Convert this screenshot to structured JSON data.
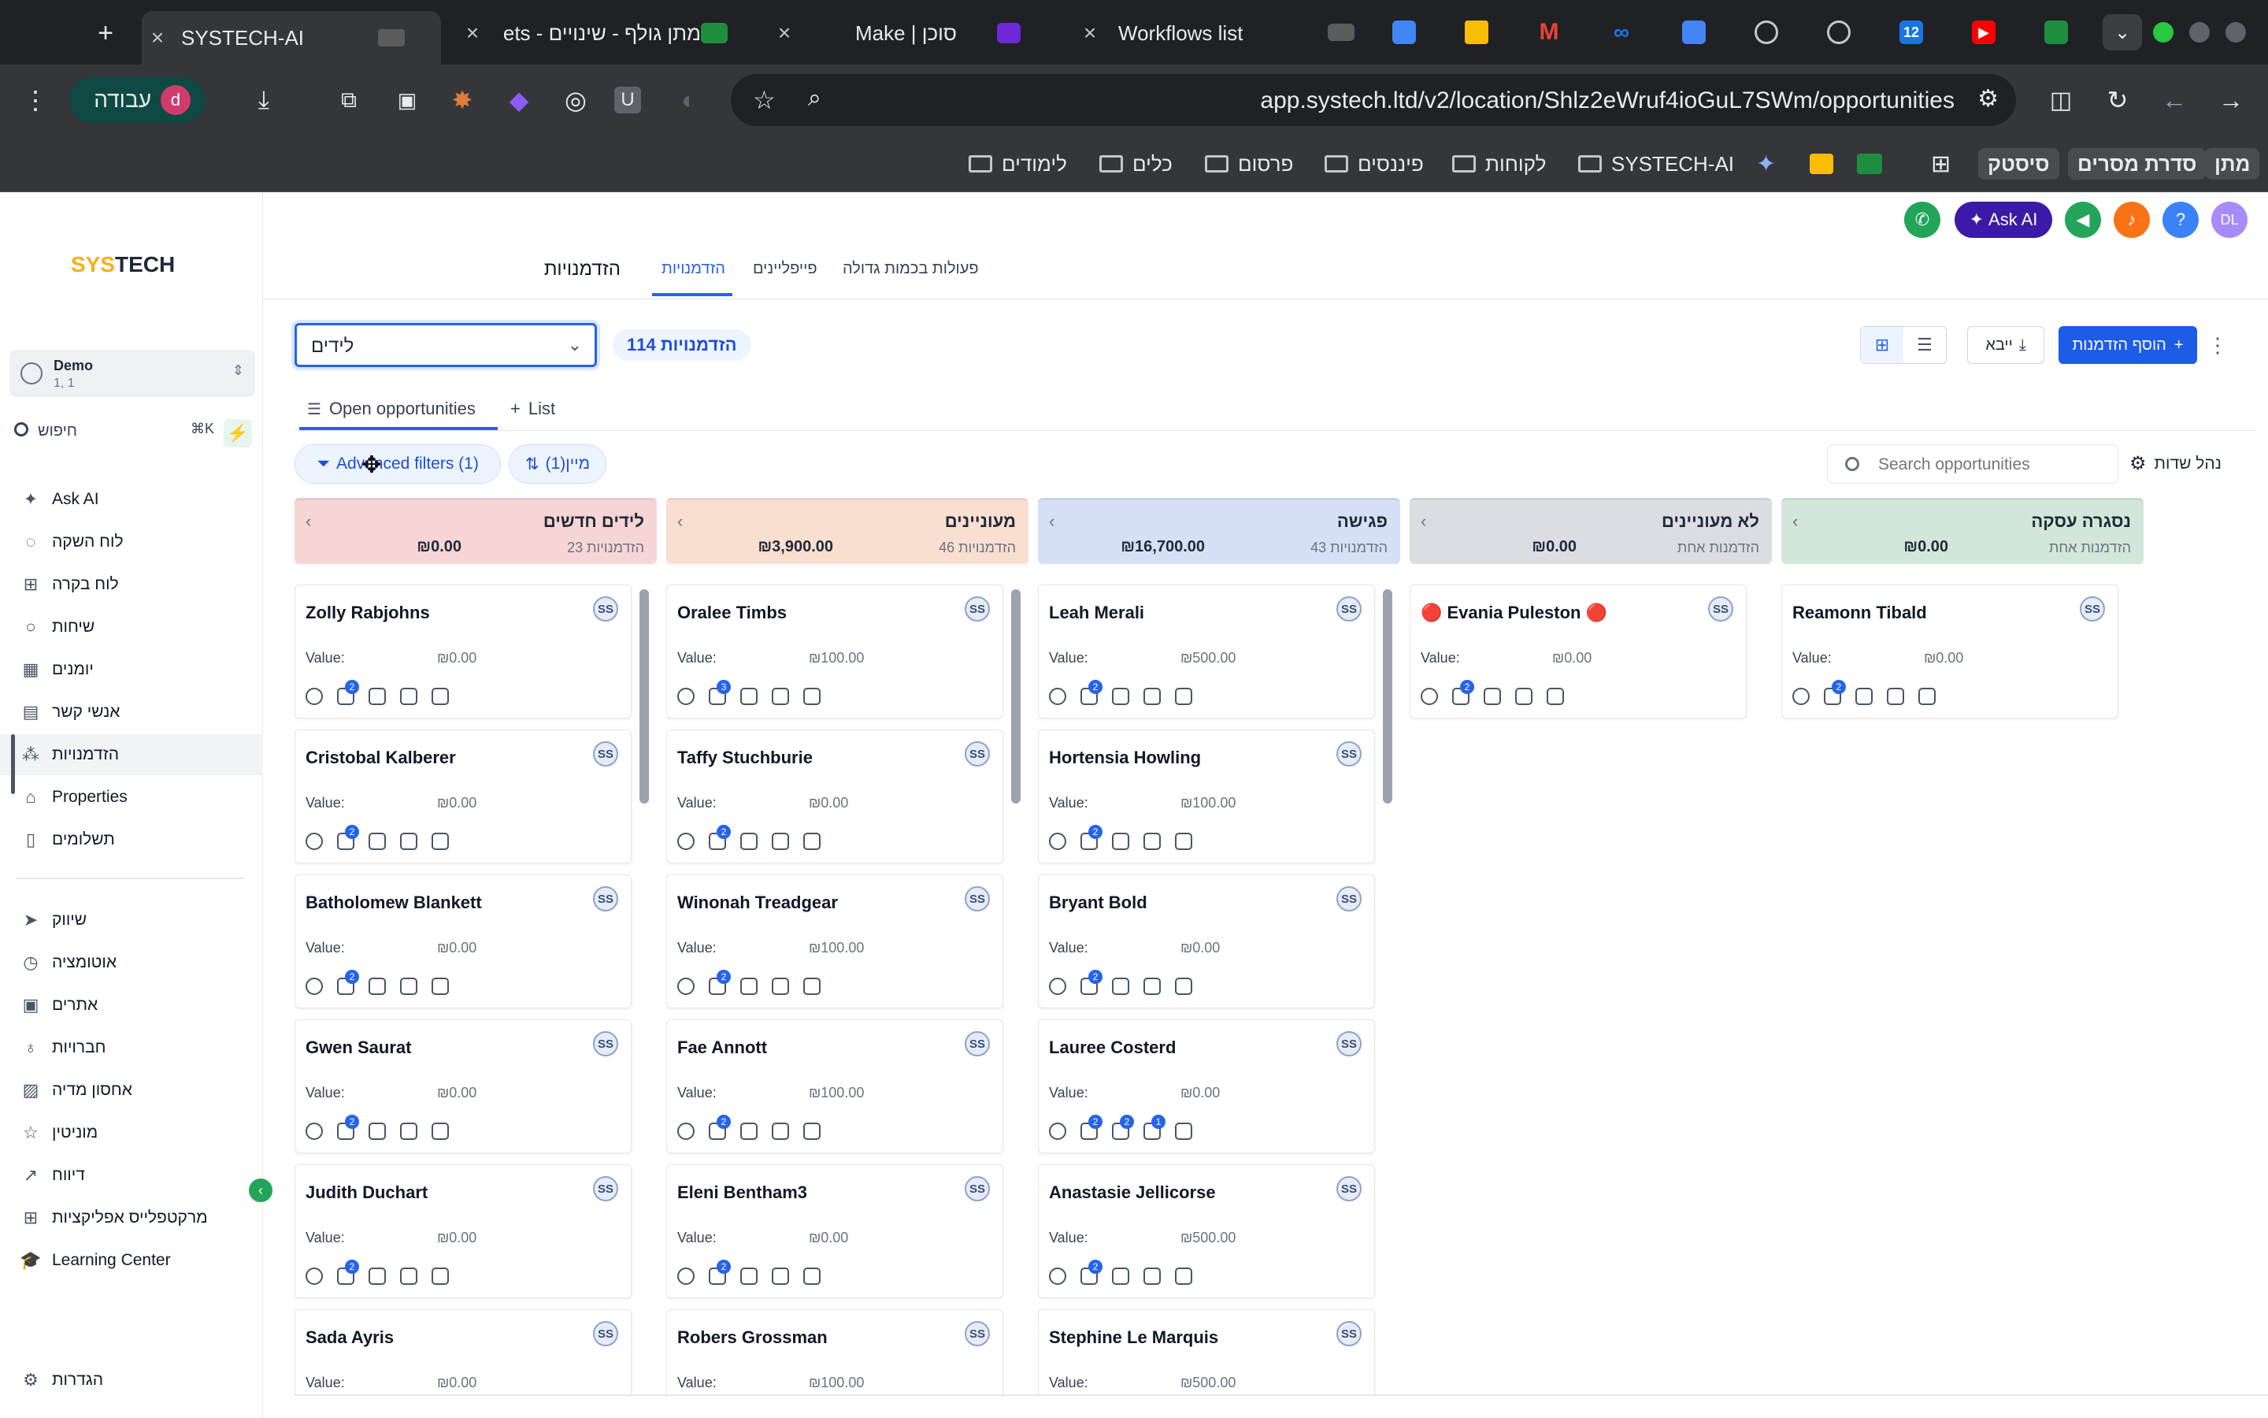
{
  "browser": {
    "tabs": [
      {
        "title": "SYSTECH-AI",
        "active": true
      },
      {
        "title": "מתן גולף - שינויים - ets",
        "active": false
      },
      {
        "title": "Make | סוכן",
        "active": false
      },
      {
        "title": "Workflows list",
        "active": false
      }
    ],
    "url": "app.systech.ltd/v2/location/Shlz2eWruf4ioGuL7SWm/opportunities",
    "profile_label": "עבודה",
    "profile_initial": "d",
    "favicon_badge": "12",
    "bookmarks": [
      "מתן",
      "סדרת מסרים",
      "סיסטק",
      "SYSTECH-AI",
      "לקוחות",
      "פיננסים",
      "פרסום",
      "כלים",
      "לימודים"
    ]
  },
  "sidebar": {
    "logo_prefix": "SYS",
    "logo_suffix": "TECH",
    "account_name": "Demo",
    "account_sub": "1, 1",
    "search_placeholder": "חיפוש",
    "search_shortcut": "⌘K",
    "items": [
      {
        "label": "Ask AI",
        "icon": "sparkle-icon"
      },
      {
        "label": "לוח השקה",
        "icon": "rocket-icon"
      },
      {
        "label": "לוח בקרה",
        "icon": "dashboard-icon"
      },
      {
        "label": "שיחות",
        "icon": "chat-icon"
      },
      {
        "label": "יומנים",
        "icon": "calendar-icon"
      },
      {
        "label": "אנשי קשר",
        "icon": "contacts-icon"
      },
      {
        "label": "הזדמנויות",
        "icon": "opportunities-icon"
      },
      {
        "label": "Properties",
        "icon": "home-icon"
      },
      {
        "label": "תשלומים",
        "icon": "payments-icon"
      },
      {
        "label": "שיווק",
        "icon": "send-icon"
      },
      {
        "label": "אוטומציה",
        "icon": "automation-icon"
      },
      {
        "label": "אתרים",
        "icon": "sites-icon"
      },
      {
        "label": "חברויות",
        "icon": "membership-icon"
      },
      {
        "label": "אחסון מדיה",
        "icon": "media-icon"
      },
      {
        "label": "מוניטין",
        "icon": "star-icon"
      },
      {
        "label": "דיווח",
        "icon": "chart-icon"
      },
      {
        "label": "מרקטפלייס אפליקציות",
        "icon": "apps-icon"
      },
      {
        "label": "Learning Center",
        "icon": "graduation-icon"
      }
    ],
    "settings_label": "הגדרות"
  },
  "topbar": {
    "ask_ai": "Ask AI",
    "user_initials": "DL",
    "help": "?"
  },
  "page": {
    "title": "הזדמנויות",
    "tabs": [
      "הזדמנויות",
      "פייפליינים",
      "פעולות בכמות גדולה"
    ],
    "pipeline_value": "לידים",
    "opp_count": "114 הזדמנויות",
    "import_label": "ייבא",
    "add_label": "הוסף הזדמנות",
    "view_tabs": [
      "Open opportunities",
      "List"
    ],
    "advanced_filters": "Advanced filters (1)",
    "sort_label": "מיין(1)",
    "search_placeholder": "Search opportunities",
    "manage_fields": "נהל שדות",
    "value_label": "Value:"
  },
  "board": {
    "columns": [
      {
        "name": "לידים חדשים",
        "value": "₪0.00",
        "count": "23 הזדמנויות",
        "color": "#f6d5d5",
        "cards": [
          {
            "name": "Zolly Rabjohns",
            "value": "₪0.00",
            "badges": [
              null,
              "2",
              null,
              null,
              null
            ]
          },
          {
            "name": "Cristobal Kalberer",
            "value": "₪0.00",
            "badges": [
              null,
              "2",
              null,
              null,
              null
            ]
          },
          {
            "name": "Batholomew Blankett",
            "value": "₪0.00",
            "badges": [
              null,
              "2",
              null,
              null,
              null
            ]
          },
          {
            "name": "Gwen Saurat",
            "value": "₪0.00",
            "badges": [
              null,
              "2",
              null,
              null,
              null
            ]
          },
          {
            "name": "Judith Duchart",
            "value": "₪0.00",
            "badges": [
              null,
              "2",
              null,
              null,
              null
            ]
          },
          {
            "name": "Sada Ayris",
            "value": "₪0.00",
            "badges": [
              null,
              null,
              null,
              null,
              null
            ]
          }
        ]
      },
      {
        "name": "מעוניינים",
        "value": "₪3,900.00",
        "count": "46 הזדמנויות",
        "color": "#f8dfd0",
        "cards": [
          {
            "name": "Oralee Timbs",
            "value": "₪100.00",
            "badges": [
              null,
              "3",
              null,
              null,
              null
            ]
          },
          {
            "name": "Taffy Stuchburie",
            "value": "₪0.00",
            "badges": [
              null,
              "2",
              null,
              null,
              null
            ]
          },
          {
            "name": "Winonah Treadgear",
            "value": "₪100.00",
            "badges": [
              null,
              "2",
              null,
              null,
              null
            ]
          },
          {
            "name": "Fae Annott",
            "value": "₪100.00",
            "badges": [
              null,
              "2",
              null,
              null,
              null
            ]
          },
          {
            "name": "Eleni Bentham3",
            "value": "₪0.00",
            "badges": [
              null,
              "2",
              null,
              null,
              null
            ]
          },
          {
            "name": "Robers Grossman",
            "value": "₪100.00",
            "badges": [
              null,
              null,
              null,
              null,
              null
            ]
          }
        ]
      },
      {
        "name": "פגישה",
        "value": "₪16,700.00",
        "count": "43 הזדמנויות",
        "color": "#d5e0f6",
        "cards": [
          {
            "name": "Leah Merali",
            "value": "₪500.00",
            "badges": [
              null,
              "2",
              null,
              null,
              null
            ]
          },
          {
            "name": "Hortensia Howling",
            "value": "₪100.00",
            "badges": [
              null,
              "2",
              null,
              null,
              null
            ]
          },
          {
            "name": "Bryant Bold",
            "value": "₪0.00",
            "badges": [
              null,
              "2",
              null,
              null,
              null
            ]
          },
          {
            "name": "Lauree Costerd",
            "value": "₪0.00",
            "badges": [
              null,
              "2",
              "2",
              "1",
              null
            ]
          },
          {
            "name": "Anastasie Jellicorse",
            "value": "₪500.00",
            "badges": [
              null,
              "2",
              null,
              null,
              null
            ]
          },
          {
            "name": "Stephine Le Marquis",
            "value": "₪500.00",
            "badges": [
              null,
              null,
              null,
              null,
              null
            ]
          }
        ]
      },
      {
        "name": "לא מעוניינים",
        "value": "₪0.00",
        "count": "הזדמנות אחת",
        "color": "#dcdde2",
        "cards": [
          {
            "name": "🔴 Evania Puleston 🔴",
            "value": "₪0.00",
            "badges": [
              null,
              "2",
              null,
              null,
              null
            ]
          }
        ]
      },
      {
        "name": "נסגרה עסקה",
        "value": "₪0.00",
        "count": "הזדמנות אחת",
        "color": "#d3e6da",
        "cards": [
          {
            "name": "Reamonn Tibald",
            "value": "₪0.00",
            "badges": [
              null,
              "2",
              null,
              null,
              null
            ]
          }
        ]
      }
    ],
    "assignee_initials": "SS"
  },
  "colors": {
    "primary": "#1d5ce6",
    "ask_ai": "#3b1aa8",
    "green": "#22a55a"
  }
}
